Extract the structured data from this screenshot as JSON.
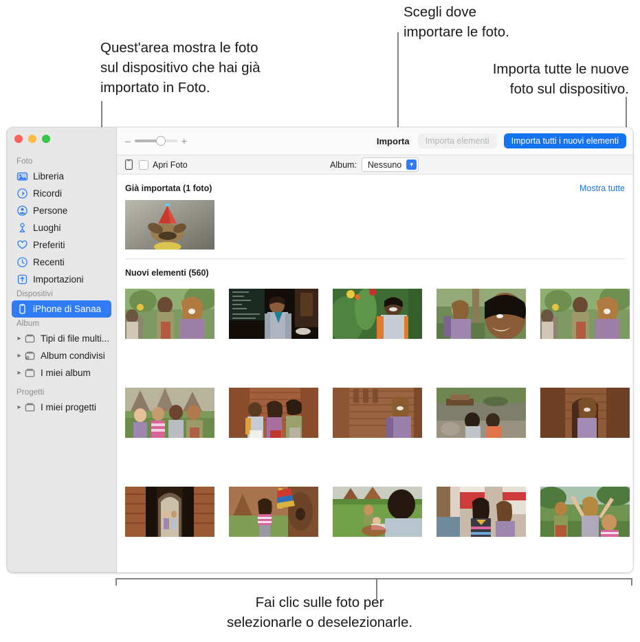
{
  "callouts": {
    "left": "Quest'area mostra le foto\nsul dispositivo che hai già\nimportato in Foto.",
    "top_middle": "Scegli dove\nimportare le foto.",
    "top_right": "Importa tutte le nuove\nfoto sul dispositivo.",
    "bottom": "Fai clic sulle foto per\nselezionarle o deselezionarle."
  },
  "window": {
    "traffic_lights": [
      "close-button",
      "minimize-button",
      "zoom-button"
    ]
  },
  "sidebar": {
    "groups": [
      {
        "header": "Foto",
        "items": [
          {
            "label": "Libreria",
            "icon": "library-icon",
            "selected": false,
            "disclosure": false
          },
          {
            "label": "Ricordi",
            "icon": "memories-icon",
            "selected": false,
            "disclosure": false
          },
          {
            "label": "Persone",
            "icon": "people-icon",
            "selected": false,
            "disclosure": false
          },
          {
            "label": "Luoghi",
            "icon": "places-icon",
            "selected": false,
            "disclosure": false
          },
          {
            "label": "Preferiti",
            "icon": "heart-icon",
            "selected": false,
            "disclosure": false
          },
          {
            "label": "Recenti",
            "icon": "clock-icon",
            "selected": false,
            "disclosure": false
          },
          {
            "label": "Importazioni",
            "icon": "import-icon",
            "selected": false,
            "disclosure": false
          }
        ]
      },
      {
        "header": "Dispositivi",
        "items": [
          {
            "label": "iPhone di Sanaa",
            "icon": "iphone-icon",
            "selected": true,
            "disclosure": false
          }
        ]
      },
      {
        "header": "Album",
        "items": [
          {
            "label": "Tipi di file multi...",
            "icon": "folder-icon",
            "selected": false,
            "disclosure": true
          },
          {
            "label": "Album condivisi",
            "icon": "shared-folder-icon",
            "selected": false,
            "disclosure": true
          },
          {
            "label": "I miei album",
            "icon": "folder-icon",
            "selected": false,
            "disclosure": true
          }
        ]
      },
      {
        "header": "Progetti",
        "items": [
          {
            "label": "I miei progetti",
            "icon": "folder-icon",
            "selected": false,
            "disclosure": true
          }
        ]
      }
    ]
  },
  "toolbar": {
    "zoom_out_label": "–",
    "zoom_in_label": "+",
    "zoom_slider_value": 52,
    "import_label": "Importa",
    "import_selected_label": "Importa elementi",
    "import_all_label": "Importa tutti i nuovi elementi",
    "primary_color": "#1473ef"
  },
  "subtoolbar": {
    "open_photos_label": "Apri Foto",
    "open_photos_checked": false,
    "album_label": "Album:",
    "album_value": "Nessuno"
  },
  "content": {
    "already_imported_title": "Già importata (1 foto)",
    "show_all_link": "Mostra tutte",
    "new_items_title": "Nuovi elementi (560)",
    "already_imported_thumbs": [
      {
        "name": "dog-party-hat-photo"
      }
    ],
    "new_item_thumbs": [
      {
        "name": "two-travelers-smiling-photo"
      },
      {
        "name": "man-at-cafe-chalkboard-photo"
      },
      {
        "name": "man-with-flowers-photo"
      },
      {
        "name": "woman-backpack-closeup-photo"
      },
      {
        "name": "two-travelers-smiling-photo-2"
      },
      {
        "name": "group-at-temple-photo"
      },
      {
        "name": "three-friends-brick-wall-photo"
      },
      {
        "name": "woman-at-ruins-photo"
      },
      {
        "name": "two-people-riverbank-photo"
      },
      {
        "name": "woman-archway-photo"
      },
      {
        "name": "couple-temple-corridor-photo"
      },
      {
        "name": "woman-colorful-tree-photo"
      },
      {
        "name": "picnic-on-grass-photo"
      },
      {
        "name": "two-women-market-photo"
      },
      {
        "name": "group-cheering-photo"
      }
    ]
  }
}
